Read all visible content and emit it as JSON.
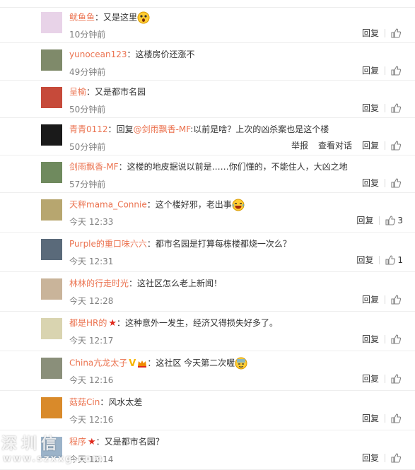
{
  "reply_label": "回复",
  "report_label": "举报",
  "view_dialog_label": "查看对话",
  "comments": [
    {
      "user": "鱿鱼鱼",
      "sep": "：",
      "text": "又是这里",
      "time": "10分钟前",
      "likes": "",
      "emoji": "surprised",
      "avatar": "#e8d3e8"
    },
    {
      "user": "yunocean123",
      "sep": "：",
      "text": "这楼房价还涨不",
      "time": "49分钟前",
      "likes": "",
      "avatar": "#7f8a6a"
    },
    {
      "user": "呈榆",
      "sep": "：",
      "text": "又是都市名园",
      "time": "50分钟前",
      "likes": "",
      "avatar": "#c64a3a"
    },
    {
      "user": "青青0112",
      "sep": "：",
      "prefix": "回复",
      "mention": "@剑雨飘香-MF",
      "text": ":以前是啥？上次的凶杀案也是这个楼",
      "time": "50分钟前",
      "likes": "",
      "avatar": "#1a1a1a",
      "extra_actions": true
    },
    {
      "user": "剑雨飘香-MF",
      "sep": "：",
      "text": "这楼的地皮据说以前是……你们懂的，不能住人，大凶之地",
      "time": "57分钟前",
      "likes": "",
      "avatar": "#6f8a5e"
    },
    {
      "user": "天秤mama_Connie",
      "sep": "：",
      "text": "这个楼好邪，老出事",
      "time": "今天 12:33",
      "likes": "3",
      "emoji": "laugh",
      "avatar": "#b7a66f"
    },
    {
      "user": "Purple的重口味六六",
      "sep": "：",
      "text": "都市名园是打算每栋楼都烧一次么？",
      "time": "今天 12:31",
      "likes": "1",
      "avatar": "#5a6a7a"
    },
    {
      "user": "林林的行走时光",
      "sep": "：",
      "text": "这社区怎么老上新闻！",
      "time": "今天 12:28",
      "likes": "",
      "avatar": "#c9b49a"
    },
    {
      "user": "都是HR的",
      "sep": "：",
      "text": "这种意外一发生，经济又得损失好多了。",
      "time": "今天 12:17",
      "likes": "",
      "badge": "star",
      "avatar": "#d9d4b0"
    },
    {
      "user": "China亢龙太子",
      "sep": "：",
      "text": "这社区 今天第二次喔",
      "time": "今天 12:16",
      "likes": "",
      "badge": "v-crown",
      "emoji": "sweat",
      "avatar": "#8a8f7a"
    },
    {
      "user": "菇菇Cin",
      "sep": "：",
      "text": "风水太差",
      "time": "今天 12:16",
      "likes": "",
      "avatar": "#d98a2a"
    },
    {
      "user": "程序",
      "sep": "：",
      "text": "又是都市名园？",
      "time": "今天 12:14",
      "likes": "",
      "badge": "star",
      "avatar": "#9bb3c9"
    }
  ],
  "watermark": {
    "cn": "深圳信",
    "url": "www.szxxg.com"
  }
}
